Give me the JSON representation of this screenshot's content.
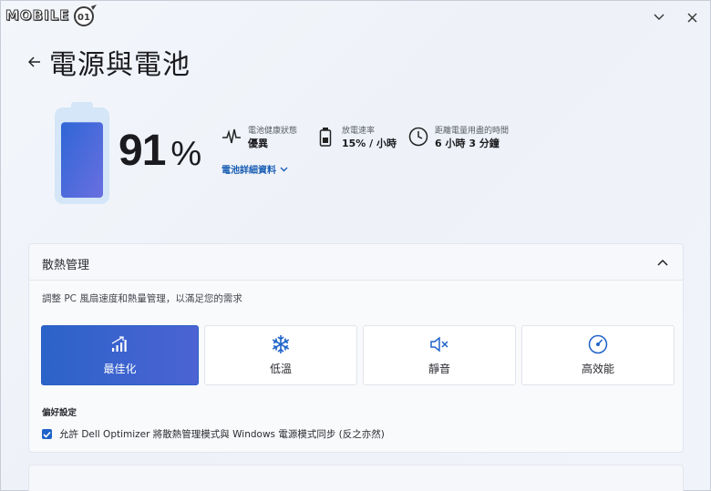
{
  "watermark": {
    "text": "MOBILE",
    "badge": "01"
  },
  "window": {
    "controls": [
      "chevron-down-icon",
      "close-icon"
    ]
  },
  "header": {
    "title": "電源與電池",
    "back_icon": "back-arrow-icon"
  },
  "battery": {
    "percent": 91,
    "percent_text": "91",
    "percent_symbol": "%",
    "fill_fraction": 0.91,
    "colors": {
      "shell": "#d4e6f7",
      "fill_top": "#2f66d6",
      "fill_bottom": "#6a6fe0"
    }
  },
  "stats": {
    "health": {
      "label": "電池健康狀態",
      "value": "優異",
      "icon": "heartbeat-icon"
    },
    "rate": {
      "label": "放電速率",
      "value": "15% / 小時",
      "icon": "battery-small-icon"
    },
    "time": {
      "label": "距離電量用盡的時間",
      "value": "6 小時 3 分鐘",
      "icon": "clock-icon"
    }
  },
  "details_link": {
    "label": "電池詳細資料"
  },
  "thermal": {
    "title": "散熱管理",
    "description": "調整 PC 風扇速度和熱量管理，以滿足您的需求",
    "modes": [
      {
        "label": "最佳化",
        "icon": "bar-chart-icon",
        "active": true
      },
      {
        "label": "低溫",
        "icon": "snowflake-icon",
        "active": false
      },
      {
        "label": "靜音",
        "icon": "mute-icon",
        "active": false
      },
      {
        "label": "高效能",
        "icon": "gauge-icon",
        "active": false
      }
    ],
    "preferences_title": "偏好設定",
    "sync_option": {
      "label": "允許 Dell Optimizer 將散熱管理模式與 Windows 電源模式同步 (反之亦然)",
      "checked": true
    }
  },
  "colors": {
    "accent": "#1f63c9",
    "link": "#1a5fb4"
  }
}
